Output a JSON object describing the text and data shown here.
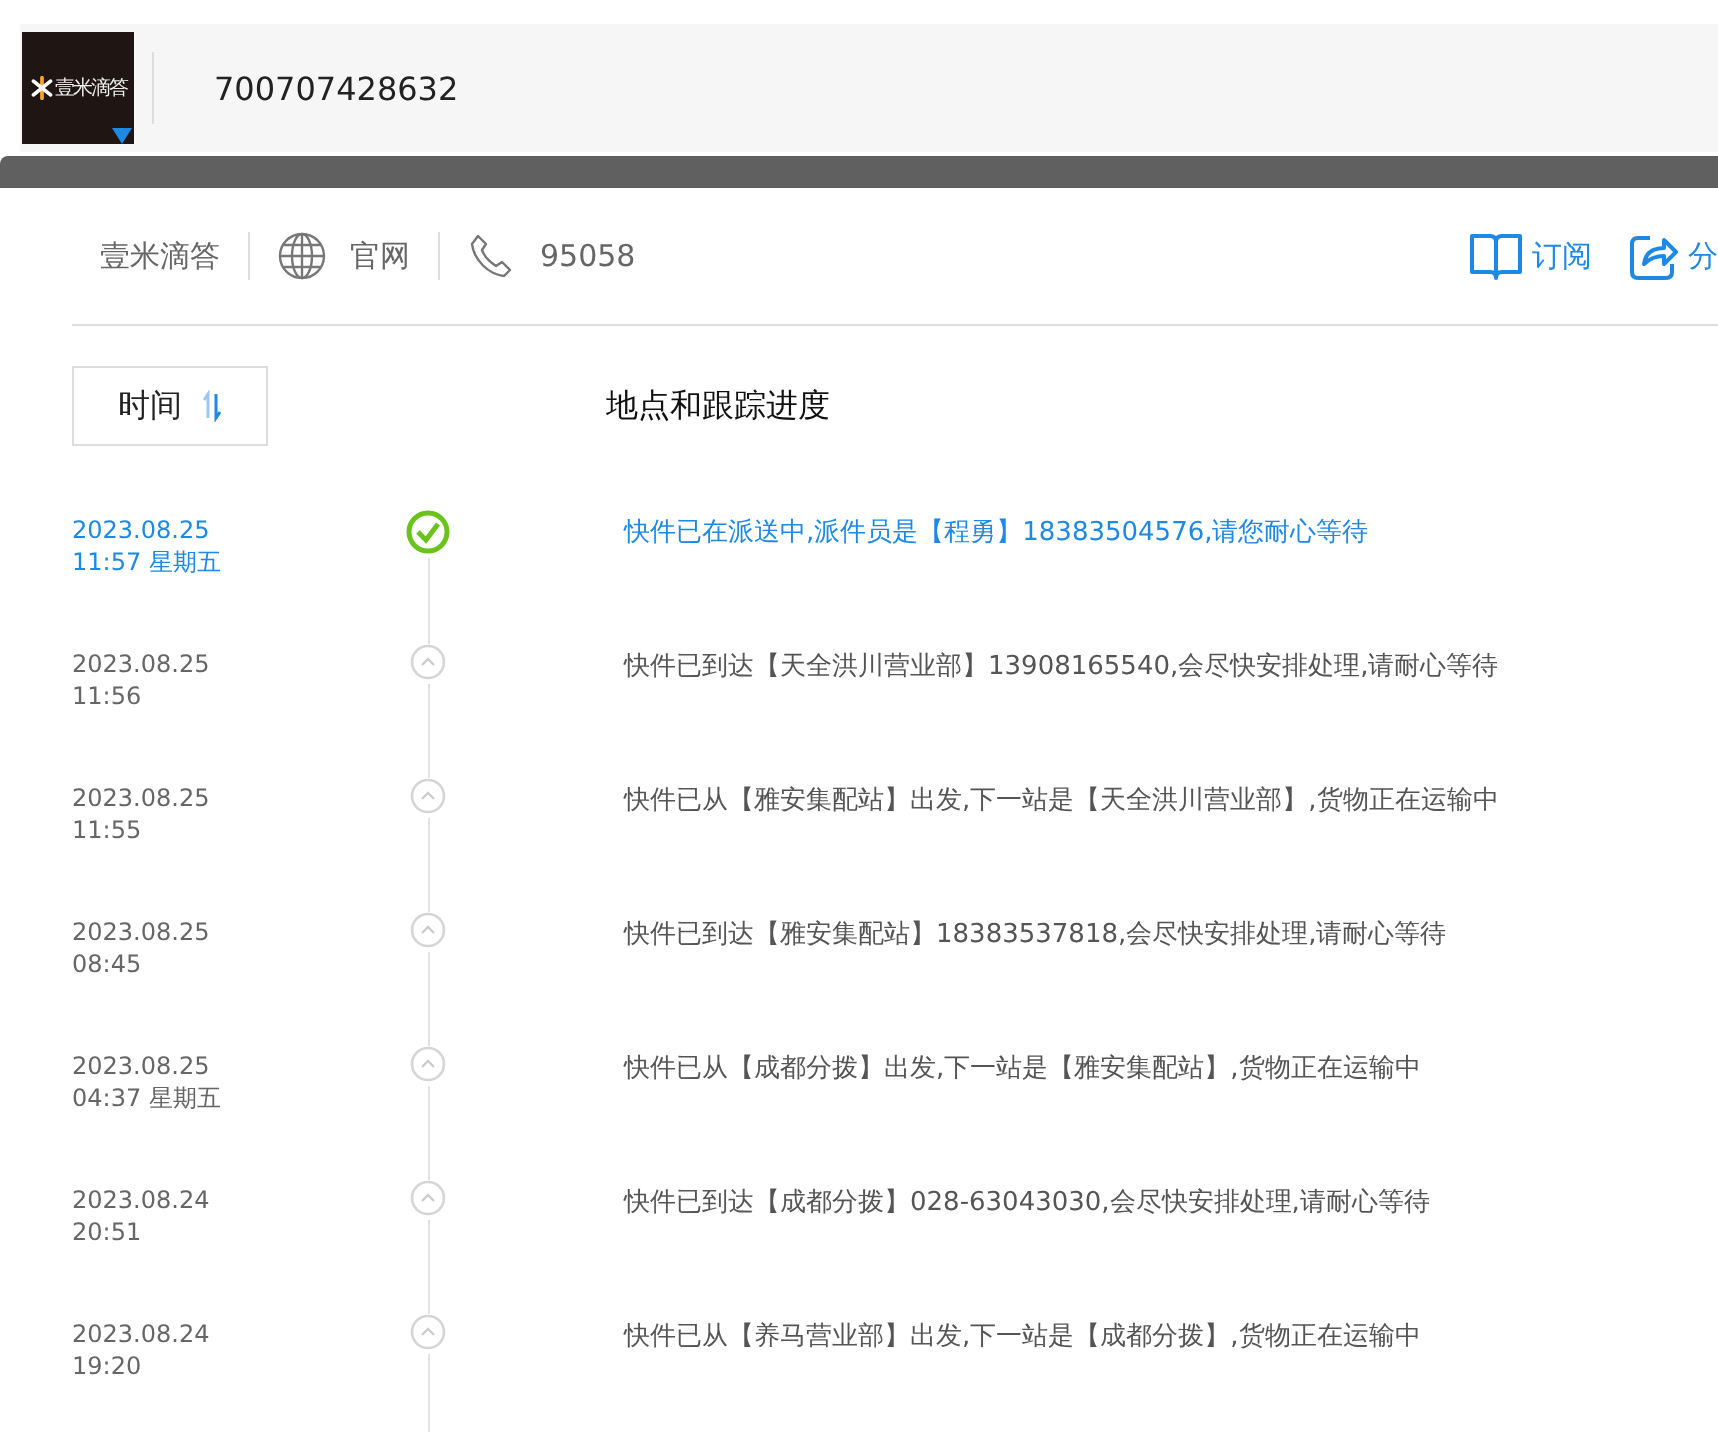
{
  "search_bar": {
    "logo_text": "壹米滴答",
    "tracking_number": "700707428632"
  },
  "company_bar": {
    "name": "壹米滴答",
    "website": "官网",
    "phone": "95058",
    "subscribe": "订阅",
    "share": "分"
  },
  "header": {
    "sort_label": "时间",
    "progress_label": "地点和跟踪进度"
  },
  "events": [
    {
      "date": "2023.08.25",
      "time": "11:57 星期五",
      "text": "快件已在派送中,派件员是【程勇】18383504576,请您耐心等待",
      "current": true
    },
    {
      "date": "2023.08.25",
      "time": "11:56",
      "text": "快件已到达【天全洪川营业部】13908165540,会尽快安排处理,请耐心等待",
      "current": false
    },
    {
      "date": "2023.08.25",
      "time": "11:55",
      "text": "快件已从【雅安集配站】出发,下一站是【天全洪川营业部】,货物正在运输中",
      "current": false
    },
    {
      "date": "2023.08.25",
      "time": "08:45",
      "text": "快件已到达【雅安集配站】18383537818,会尽快安排处理,请耐心等待",
      "current": false
    },
    {
      "date": "2023.08.25",
      "time": "04:37 星期五",
      "text": "快件已从【成都分拨】出发,下一站是【雅安集配站】,货物正在运输中",
      "current": false
    },
    {
      "date": "2023.08.24",
      "time": "20:51",
      "text": "快件已到达【成都分拨】028-63043030,会尽快安排处理,请耐心等待",
      "current": false
    },
    {
      "date": "2023.08.24",
      "time": "19:20",
      "text": "快件已从【养马营业部】出发,下一站是【成都分拨】,货物正在运输中",
      "current": false
    }
  ]
}
